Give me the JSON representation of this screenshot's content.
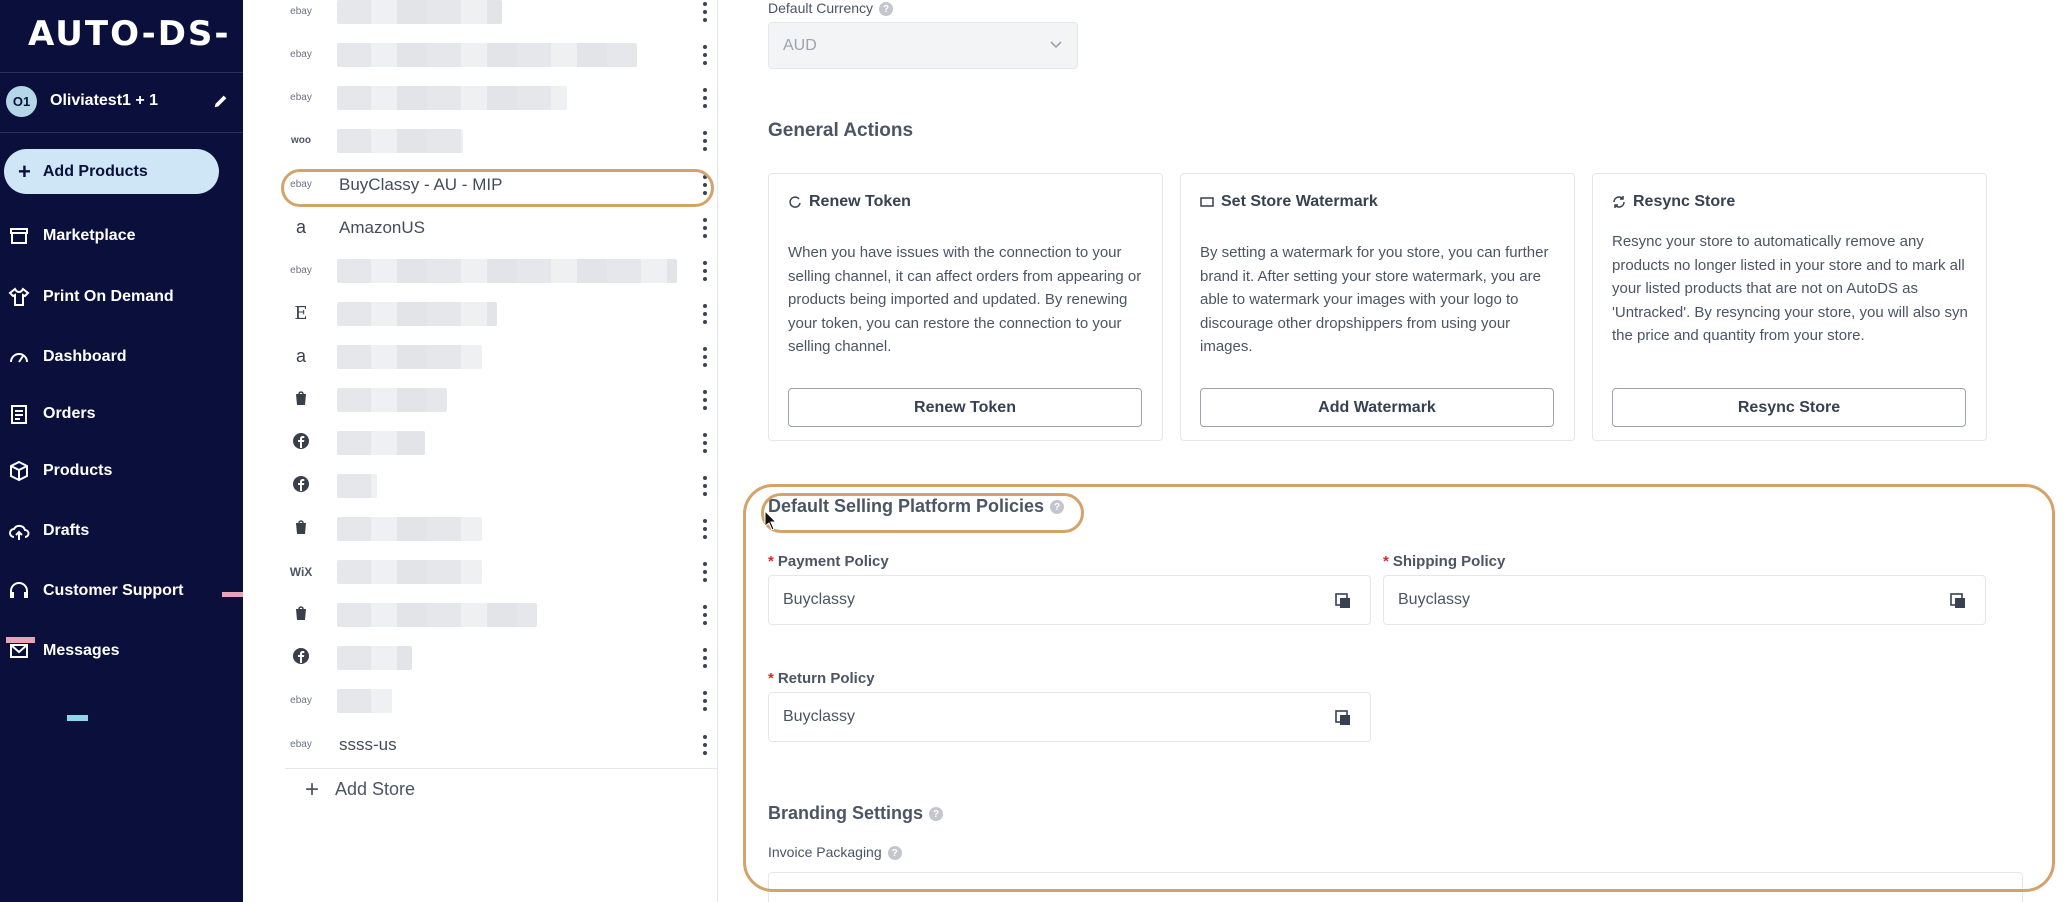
{
  "sidebar": {
    "logo": "AUTO-DS-",
    "account": {
      "initials": "O1",
      "name": "Oliviatest1 + 1"
    },
    "add_products": "Add Products",
    "nav": [
      {
        "label": "Marketplace",
        "icon": "store-icon"
      },
      {
        "label": "Print On Demand",
        "icon": "shirt-icon"
      },
      {
        "label": "Dashboard",
        "icon": "gauge-icon"
      },
      {
        "label": "Orders",
        "icon": "clipboard-icon"
      },
      {
        "label": "Products",
        "icon": "box-icon"
      },
      {
        "label": "Drafts",
        "icon": "cloud-upload-icon"
      },
      {
        "label": "Customer Support",
        "icon": "headset-icon"
      },
      {
        "label": "Messages",
        "icon": "mail-icon"
      }
    ]
  },
  "stores": {
    "items": [
      {
        "platform": "ebay",
        "name": ""
      },
      {
        "platform": "ebay",
        "name": ""
      },
      {
        "platform": "ebay",
        "name": ""
      },
      {
        "platform": "woo",
        "name": ""
      },
      {
        "platform": "ebay",
        "name": "BuyClassy - AU - MIP",
        "selected": true
      },
      {
        "platform": "amazon",
        "name": "AmazonUS"
      },
      {
        "platform": "ebay",
        "name": ""
      },
      {
        "platform": "etsy",
        "name": ""
      },
      {
        "platform": "amazon",
        "name": ""
      },
      {
        "platform": "shopify",
        "name": ""
      },
      {
        "platform": "facebook",
        "name": ""
      },
      {
        "platform": "facebook",
        "name": ""
      },
      {
        "platform": "shopify",
        "name": ""
      },
      {
        "platform": "wix",
        "name": ""
      },
      {
        "platform": "shopify",
        "name": ""
      },
      {
        "platform": "facebook",
        "name": ""
      },
      {
        "platform": "ebay",
        "name": ""
      },
      {
        "platform": "ebay",
        "name": "ssss-us"
      }
    ],
    "add_store": "Add Store",
    "platform_labels": {
      "ebay": "ebay",
      "woo": "woo",
      "amazon": "a",
      "etsy": "E",
      "wix": "WiX"
    }
  },
  "main": {
    "default_currency": {
      "label": "Default Currency",
      "value": "AUD"
    },
    "general_actions": {
      "title": "General Actions",
      "cards": [
        {
          "title": "Renew Token",
          "description": "When you have issues with the connection to your selling channel, it can affect orders from appearing or products being imported and updated. By renewing your token, you can restore the connection to your selling channel.",
          "button": "Renew Token"
        },
        {
          "title": "Set Store Watermark",
          "description": "By setting a watermark for you store, you can further brand it. After setting your store watermark, you are able to watermark your images with your logo to discourage other dropshippers from using your images.",
          "button": "Add Watermark"
        },
        {
          "title": "Resync Store",
          "description": "Resync your store to automatically remove any products no longer listed in your store and to mark all your listed products that are not on AutoDS as 'Untracked'. By resyncing your store, you will also syn the price and quantity from your store.",
          "button": "Resync Store"
        }
      ]
    },
    "policies": {
      "title": "Default Selling Platform Policies",
      "payment": {
        "label": "Payment Policy",
        "value": "Buyclassy"
      },
      "shipping": {
        "label": "Shipping Policy",
        "value": "Buyclassy"
      },
      "return": {
        "label": "Return Policy",
        "value": "Buyclassy"
      },
      "required_mark": "*"
    },
    "branding": {
      "title": "Branding Settings",
      "invoice_packaging": "Invoice Packaging"
    }
  },
  "colors": {
    "sidebar_bg": "#0b0f3c",
    "add_products_bg": "#cfe6f7",
    "highlight": "#d4a36a",
    "required": "#dc2626"
  }
}
